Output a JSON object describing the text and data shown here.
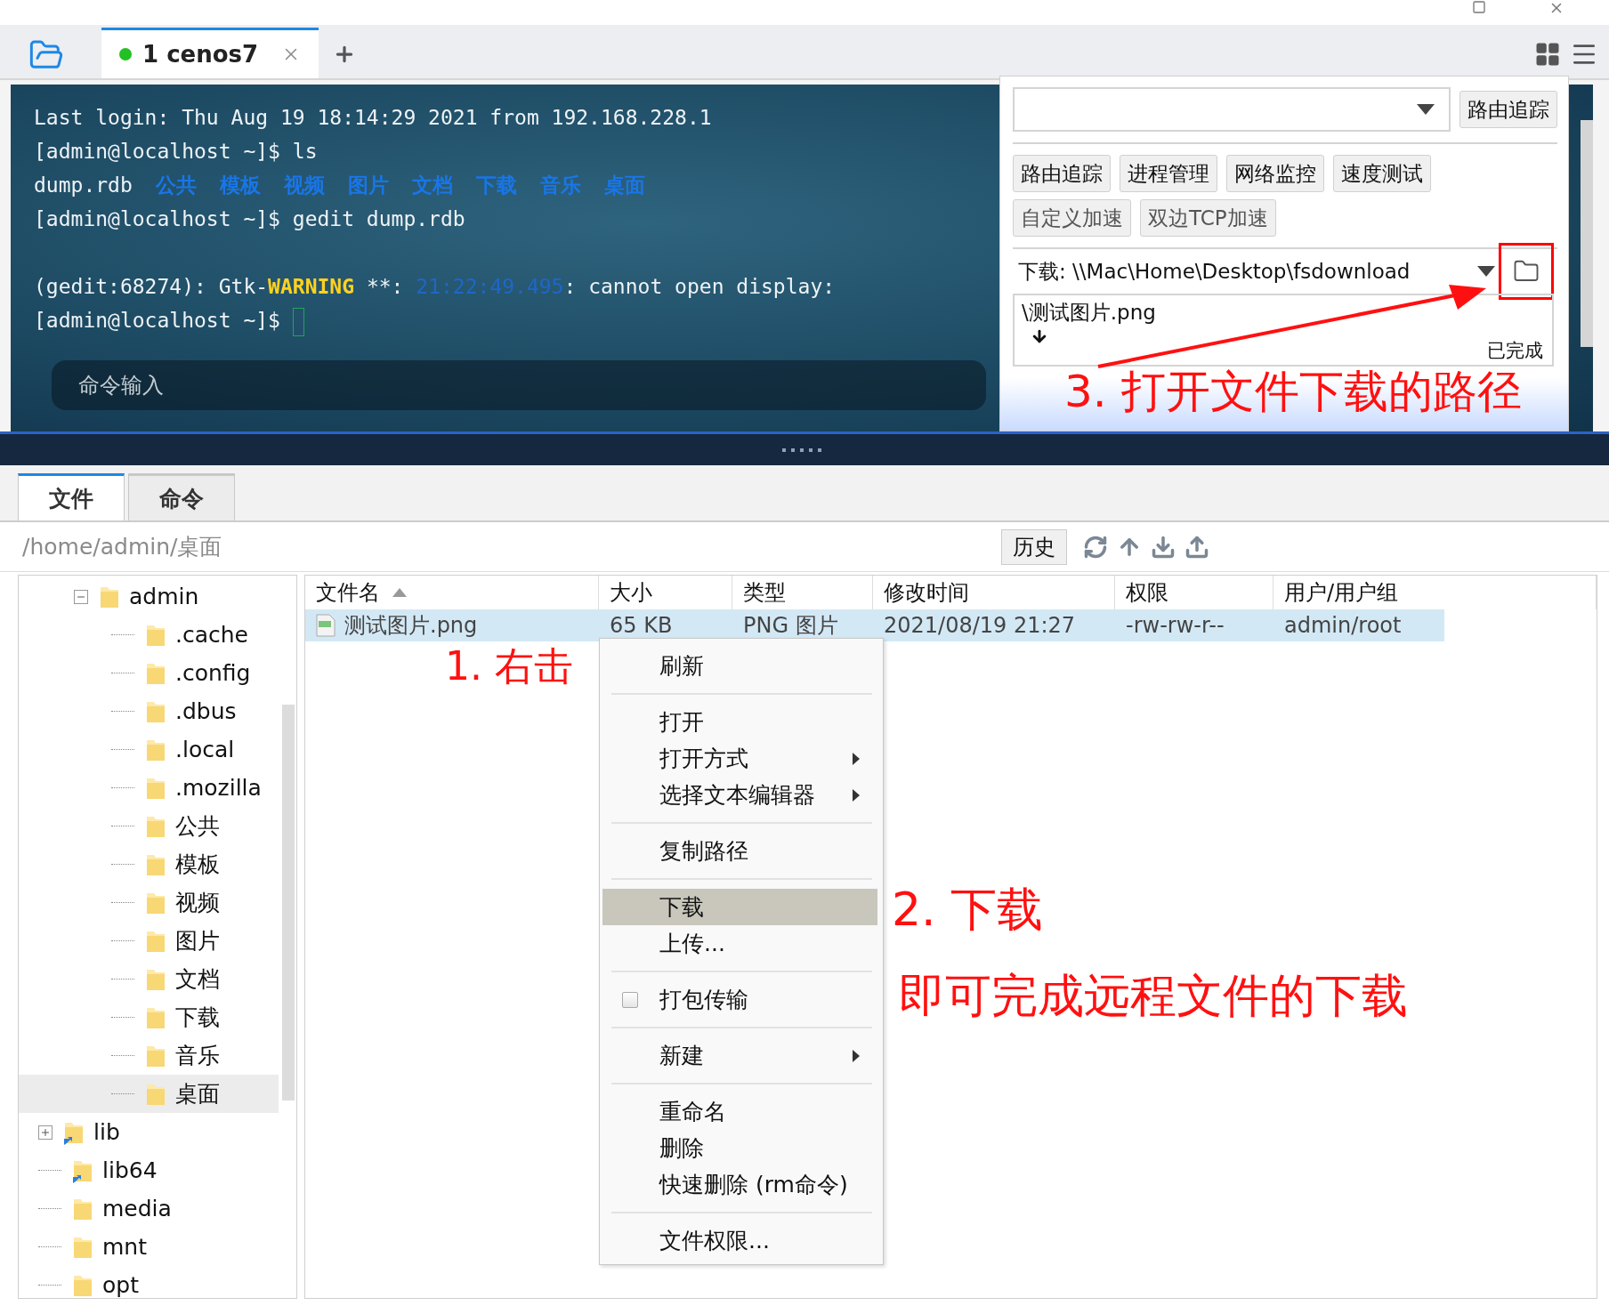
{
  "session_tabs": [
    {
      "label": "1 cenos7",
      "selected": true,
      "connected": true
    }
  ],
  "terminal": {
    "lines": [
      {
        "kind": "text",
        "cursor": false,
        "segments": [
          {
            "kind": "plain",
            "text": "Last login: Thu Aug 19 18:14:29 2021 from 192.168.228.1"
          }
        ]
      },
      {
        "kind": "text",
        "cursor": false,
        "segments": [
          {
            "kind": "plain",
            "text": "[admin@localhost ~]$ ls"
          }
        ]
      },
      {
        "kind": "text",
        "cursor": false,
        "segments": [
          {
            "kind": "plain",
            "text": "dump.rdb"
          },
          {
            "kind": "dir",
            "text": "公共"
          },
          {
            "kind": "dir",
            "text": "模板"
          },
          {
            "kind": "dir",
            "text": "视频"
          },
          {
            "kind": "dir",
            "text": "图片"
          },
          {
            "kind": "dir",
            "text": "文档"
          },
          {
            "kind": "dir",
            "text": "下载"
          },
          {
            "kind": "dir",
            "text": "音乐"
          },
          {
            "kind": "dir",
            "text": "桌面"
          }
        ]
      },
      {
        "kind": "text",
        "cursor": false,
        "segments": [
          {
            "kind": "plain",
            "text": "[admin@localhost ~]$ gedit dump.rdb"
          }
        ]
      },
      {
        "kind": "blank"
      },
      {
        "kind": "text",
        "cursor": false,
        "segments": [
          {
            "kind": "plain",
            "text": "(gedit:68274): Gtk-"
          },
          {
            "kind": "warning",
            "text": "WARNING"
          },
          {
            "kind": "plain",
            "text": " **: "
          },
          {
            "kind": "time",
            "text": "21:22:49.495"
          },
          {
            "kind": "plain",
            "text": ": cannot open display:"
          }
        ]
      },
      {
        "kind": "text",
        "cursor": true,
        "segments": [
          {
            "kind": "plain",
            "text": "[admin@localhost ~]$ "
          }
        ]
      }
    ],
    "command_input": {
      "placeholder": "命令输入"
    }
  },
  "tools_panel": {
    "trace_button": "路由追踪",
    "tool_buttons": [
      "路由追踪",
      "进程管理",
      "网络监控",
      "速度测试",
      "自定义加速",
      "双边TCP加速"
    ],
    "download": {
      "path_label": "下载: \\\\Mac\\Home\\Desktop\\fsdownload",
      "items": [
        {
          "name": "\\测试图片.png",
          "status": "已完成"
        }
      ]
    }
  },
  "file_panel": {
    "tabs": [
      {
        "label": "文件",
        "selected": true
      },
      {
        "label": "命令",
        "selected": false
      }
    ],
    "path": "/home/admin/桌面",
    "history_button": "历史",
    "tree": {
      "upper_branch": [
        {
          "label": "admin",
          "expanded": true,
          "symlink": false,
          "selected": false,
          "children": [
            {
              "label": ".cache",
              "symlink": false,
              "selected": false
            },
            {
              "label": ".config",
              "symlink": false,
              "selected": false
            },
            {
              "label": ".dbus",
              "symlink": false,
              "selected": false
            },
            {
              "label": ".local",
              "symlink": false,
              "selected": false
            },
            {
              "label": ".mozilla",
              "symlink": false,
              "selected": false
            },
            {
              "label": "公共",
              "symlink": false,
              "selected": false
            },
            {
              "label": "模板",
              "symlink": false,
              "selected": false
            },
            {
              "label": "视频",
              "symlink": false,
              "selected": false
            },
            {
              "label": "图片",
              "symlink": false,
              "selected": false
            },
            {
              "label": "文档",
              "symlink": false,
              "selected": false
            },
            {
              "label": "下载",
              "symlink": false,
              "selected": false
            },
            {
              "label": "音乐",
              "symlink": false,
              "selected": false
            },
            {
              "label": "桌面",
              "symlink": false,
              "selected": true
            }
          ]
        }
      ],
      "items": [
        {
          "label": "lib",
          "expanded": false,
          "symlink": true,
          "selected": false
        },
        {
          "label": "lib64",
          "symlink": true,
          "selected": false
        },
        {
          "label": "media",
          "symlink": false,
          "selected": false
        },
        {
          "label": "mnt",
          "symlink": false,
          "selected": false
        },
        {
          "label": "opt",
          "symlink": false,
          "selected": false
        }
      ]
    },
    "files": {
      "columns": [
        {
          "label": "文件名",
          "sorted": true
        },
        {
          "label": "大小",
          "sorted": false
        },
        {
          "label": "类型",
          "sorted": false
        },
        {
          "label": "修改时间",
          "sorted": false
        },
        {
          "label": "权限",
          "sorted": false
        },
        {
          "label": "用户/用户组",
          "sorted": false
        }
      ],
      "rows": [
        {
          "selected": true,
          "cells": [
            "测试图片.png",
            "65 KB",
            "PNG 图片",
            "2021/08/19 21:27",
            "-rw-rw-r--",
            "admin/root"
          ]
        }
      ]
    }
  },
  "context_menu": {
    "groups": [
      [
        {
          "label": "刷新",
          "kind": "plain",
          "selected": false
        }
      ],
      [
        {
          "label": "打开",
          "kind": "plain",
          "selected": false
        },
        {
          "label": "打开方式",
          "kind": "submenu",
          "selected": false
        },
        {
          "label": "选择文本编辑器",
          "kind": "submenu",
          "selected": false
        }
      ],
      [
        {
          "label": "复制路径",
          "kind": "plain",
          "selected": false
        }
      ],
      [
        {
          "label": "下载",
          "kind": "plain",
          "selected": true
        },
        {
          "label": "上传...",
          "kind": "plain",
          "selected": false
        }
      ],
      [
        {
          "label": "打包传输",
          "kind": "checkbox",
          "checked": false,
          "selected": false
        }
      ],
      [
        {
          "label": "新建",
          "kind": "submenu",
          "selected": false
        }
      ],
      [
        {
          "label": "重命名",
          "kind": "plain",
          "selected": false
        },
        {
          "label": "删除",
          "kind": "plain",
          "selected": false
        },
        {
          "label": "快速删除 (rm命令)",
          "kind": "plain",
          "selected": false
        }
      ],
      [
        {
          "label": "文件权限...",
          "kind": "plain",
          "selected": false
        }
      ]
    ]
  },
  "annotations": [
    {
      "text": "1. 右击"
    },
    {
      "text": "2. 下载"
    },
    {
      "text": "3. 打开文件下载的路径"
    },
    {
      "text": "即可完成远程文件的下载"
    }
  ]
}
